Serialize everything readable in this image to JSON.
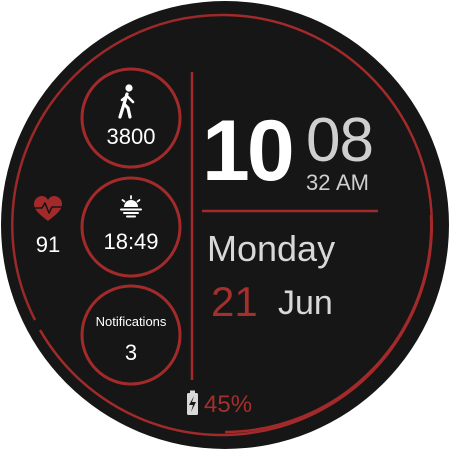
{
  "colors": {
    "background": "#161616",
    "accent": "#a32a2a",
    "text_white": "#ffffff",
    "text_gray": "#cfcfcf",
    "date_red": "#a3302d"
  },
  "steps": {
    "icon": "walking-icon",
    "value": "3800"
  },
  "sunrise": {
    "icon": "sunrise-icon",
    "value": "18:49"
  },
  "notifications": {
    "label": "Notifications",
    "count": "3"
  },
  "heart_rate": {
    "icon": "heart-rate-icon",
    "value": "91"
  },
  "time": {
    "hour": "10",
    "minute": "08",
    "seconds": "32",
    "ampm": "AM"
  },
  "date": {
    "weekday": "Monday",
    "day": "21",
    "month": "Jun"
  },
  "battery": {
    "icon": "battery-charging-icon",
    "percent": "45%"
  }
}
